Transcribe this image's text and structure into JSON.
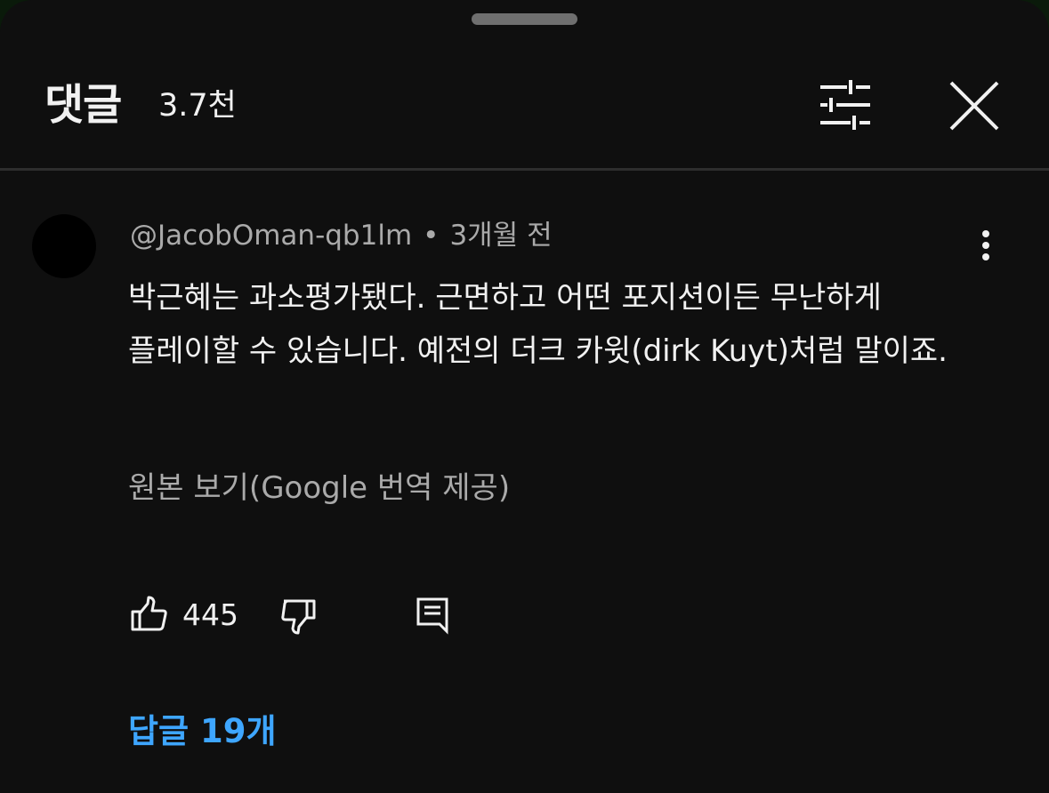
{
  "header": {
    "title": "댓글",
    "count": "3.7천"
  },
  "icons": {
    "filter": "sliders-icon",
    "close": "close-icon",
    "more": "more-vert-icon",
    "like": "thumbs-up-icon",
    "dislike": "thumbs-down-icon",
    "reply": "reply-comment-icon"
  },
  "comment": {
    "author": "@JacobOman-qb1lm",
    "separator": "•",
    "time": "3개월 전",
    "text": "박근혜는 과소평가됐다. 근면하고 어떤 포지션이든 무난하게 플레이할 수 있습니다. 예전의 더크 카윗(dirk Kuyt)처럼 말이죠.",
    "translation_link": "원본 보기(Google 번역 제공)",
    "like_count": "445",
    "replies_label": "답글 19개"
  },
  "colors": {
    "background": "#0f0f0f",
    "text_primary": "#f1f1f1",
    "text_secondary": "#aaaaaa",
    "link_blue": "#3ea6ff",
    "divider": "#2e2e2e"
  }
}
